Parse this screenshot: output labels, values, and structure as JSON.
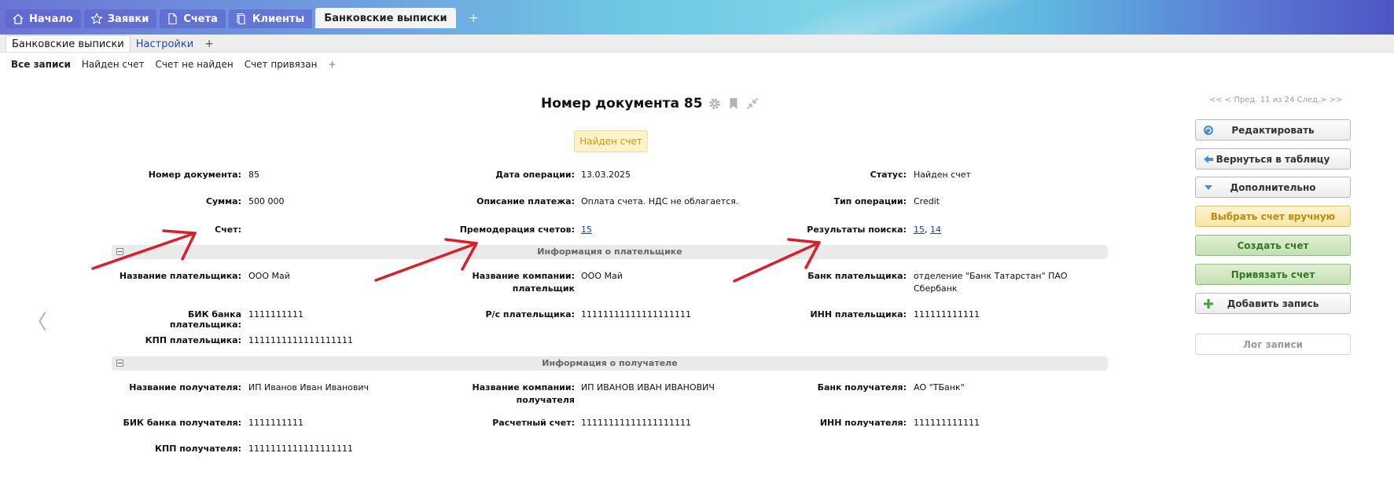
{
  "top_tabs": [
    {
      "label": "Начало",
      "icon": "home-icon"
    },
    {
      "label": "Заявки",
      "icon": "star-icon"
    },
    {
      "label": "Счета",
      "icon": "document-icon"
    },
    {
      "label": "Клиенты",
      "icon": "copy-icon"
    },
    {
      "label": "Банковские выписки",
      "active": true
    }
  ],
  "top_add": "+",
  "sub_tabs": [
    {
      "label": "Банковские выписки",
      "active": true
    },
    {
      "label": "Настройки"
    },
    {
      "label": "+"
    }
  ],
  "filters": [
    "Все записи",
    "Найден счет",
    "Счет не найден",
    "Счет привязан",
    "+"
  ],
  "title": "Номер документа 85",
  "status_badge": "Найден счет",
  "fields": {
    "doc_number": {
      "label": "Номер документа:",
      "value": "85"
    },
    "op_date": {
      "label": "Дата операции:",
      "value": "13.03.2025"
    },
    "status": {
      "label": "Статус:",
      "value": "Найден счет"
    },
    "amount": {
      "label": "Сумма:",
      "value": "500 000"
    },
    "pay_desc": {
      "label": "Описание платежа:",
      "value": "Оплата счета. НДС не облагается."
    },
    "op_type": {
      "label": "Тип операции:",
      "value": "Credit"
    },
    "account": {
      "label": "Счет:",
      "value": ""
    },
    "premod": {
      "label": "Премодерация счетов:",
      "value": "15"
    },
    "search_results": {
      "label": "Результаты поиска:",
      "values": [
        "15",
        "14"
      ],
      "separator": ", "
    }
  },
  "payer_section": {
    "title": "Информация о плательщике",
    "payer_name": {
      "label": "Название плательщика:",
      "value": "ООО Май"
    },
    "company_name": {
      "label_line1": "Название компании:",
      "label_line2": "плательщик",
      "value": "ООО Май"
    },
    "bank": {
      "label": "Банк плательщика:",
      "value_line1": "отделение \"Банк Татарстан\" ПАО",
      "value_line2": "Сбербанк"
    },
    "bik": {
      "label": "БИК банка плательщика:",
      "value": "1111111111"
    },
    "rs": {
      "label": "Р/с плательщика:",
      "value": "11111111111111111111"
    },
    "inn": {
      "label": "ИНН плательщика:",
      "value": "111111111111"
    },
    "kpp": {
      "label": "КПП плательщика:",
      "value": "1111111111111111111"
    }
  },
  "receiver_section": {
    "title": "Информация о получателе",
    "receiver_name": {
      "label": "Название получателя:",
      "value": "ИП Иванов Иван Иванович"
    },
    "company_name": {
      "label_line1": "Название компании:",
      "label_line2": "получателя",
      "value": "ИП ИВАНОВ ИВАН ИВАНОВИЧ"
    },
    "bank": {
      "label": "Банк получателя:",
      "value": "АО \"ТБанк\""
    },
    "bik": {
      "label": "БИК банка получателя:",
      "value": "1111111111"
    },
    "account": {
      "label": "Расчетный счет:",
      "value": "11111111111111111111"
    },
    "inn": {
      "label": "ИНН получателя:",
      "value": "111111111111"
    },
    "kpp": {
      "label": "КПП получателя:",
      "value": "1111111111111111111"
    }
  },
  "pager": "<< < Пред. 11 из 24 След.> >>",
  "actions": {
    "edit": "Редактировать",
    "back": "Вернуться в таблицу",
    "more": "Дополнительно",
    "choose_manual": "Выбрать счет вручную",
    "create": "Создать счет",
    "link": "Привязать счет",
    "add_record": "Добавить запись",
    "log": "Лог записи"
  },
  "colors": {
    "annotation_arrow": "#d9202a",
    "badge_bg": "#fdf1c7",
    "link": "#1a3fc0"
  }
}
